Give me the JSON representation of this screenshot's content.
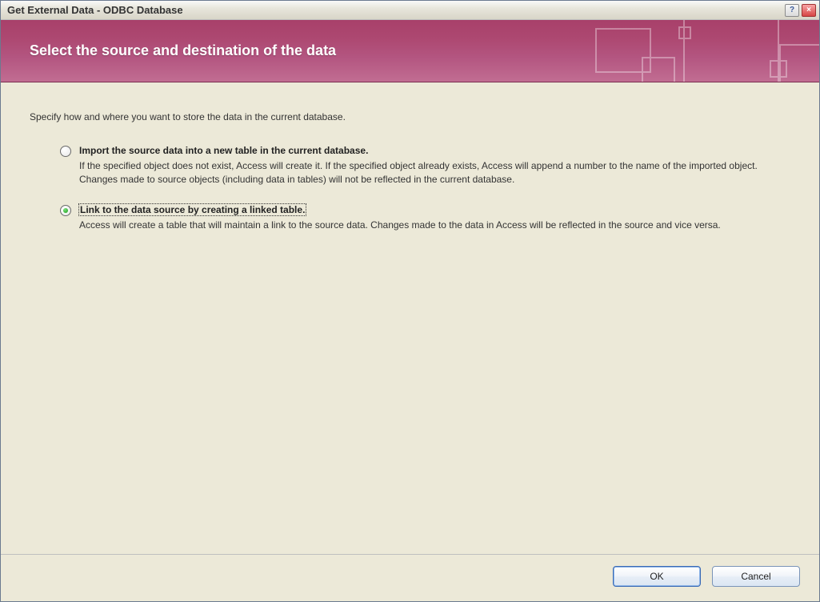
{
  "window": {
    "title": "Get External Data - ODBC Database"
  },
  "banner": {
    "heading": "Select the source and destination of the data"
  },
  "instruction": "Specify how and where you want to store the data in the current database.",
  "options": {
    "import": {
      "label": "Import the source data into a new table in the current database.",
      "description": "If the specified object does not exist, Access will create it. If the specified object already exists, Access will append a number to the name of the imported object. Changes made to source objects (including data in tables) will not be reflected in the current database.",
      "selected": false
    },
    "link": {
      "label": "Link to the data source by creating a linked table.",
      "description": "Access will create a table that will maintain a link to the source data. Changes made to the data in Access will be reflected in the source and vice versa.",
      "selected": true
    }
  },
  "buttons": {
    "ok": "OK",
    "cancel": "Cancel",
    "help": "?",
    "close": "×"
  }
}
